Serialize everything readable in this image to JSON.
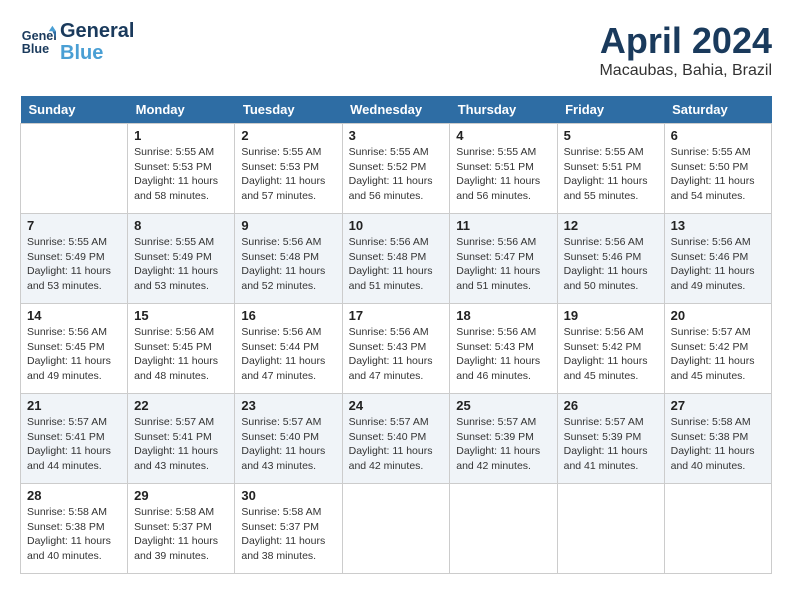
{
  "header": {
    "logo_line1": "General",
    "logo_line2": "Blue",
    "month": "April 2024",
    "location": "Macaubas, Bahia, Brazil"
  },
  "weekdays": [
    "Sunday",
    "Monday",
    "Tuesday",
    "Wednesday",
    "Thursday",
    "Friday",
    "Saturday"
  ],
  "weeks": [
    [
      {
        "day": "",
        "info": ""
      },
      {
        "day": "1",
        "info": "Sunrise: 5:55 AM\nSunset: 5:53 PM\nDaylight: 11 hours\nand 58 minutes."
      },
      {
        "day": "2",
        "info": "Sunrise: 5:55 AM\nSunset: 5:53 PM\nDaylight: 11 hours\nand 57 minutes."
      },
      {
        "day": "3",
        "info": "Sunrise: 5:55 AM\nSunset: 5:52 PM\nDaylight: 11 hours\nand 56 minutes."
      },
      {
        "day": "4",
        "info": "Sunrise: 5:55 AM\nSunset: 5:51 PM\nDaylight: 11 hours\nand 56 minutes."
      },
      {
        "day": "5",
        "info": "Sunrise: 5:55 AM\nSunset: 5:51 PM\nDaylight: 11 hours\nand 55 minutes."
      },
      {
        "day": "6",
        "info": "Sunrise: 5:55 AM\nSunset: 5:50 PM\nDaylight: 11 hours\nand 54 minutes."
      }
    ],
    [
      {
        "day": "7",
        "info": "Sunrise: 5:55 AM\nSunset: 5:49 PM\nDaylight: 11 hours\nand 53 minutes."
      },
      {
        "day": "8",
        "info": "Sunrise: 5:55 AM\nSunset: 5:49 PM\nDaylight: 11 hours\nand 53 minutes."
      },
      {
        "day": "9",
        "info": "Sunrise: 5:56 AM\nSunset: 5:48 PM\nDaylight: 11 hours\nand 52 minutes."
      },
      {
        "day": "10",
        "info": "Sunrise: 5:56 AM\nSunset: 5:48 PM\nDaylight: 11 hours\nand 51 minutes."
      },
      {
        "day": "11",
        "info": "Sunrise: 5:56 AM\nSunset: 5:47 PM\nDaylight: 11 hours\nand 51 minutes."
      },
      {
        "day": "12",
        "info": "Sunrise: 5:56 AM\nSunset: 5:46 PM\nDaylight: 11 hours\nand 50 minutes."
      },
      {
        "day": "13",
        "info": "Sunrise: 5:56 AM\nSunset: 5:46 PM\nDaylight: 11 hours\nand 49 minutes."
      }
    ],
    [
      {
        "day": "14",
        "info": "Sunrise: 5:56 AM\nSunset: 5:45 PM\nDaylight: 11 hours\nand 49 minutes."
      },
      {
        "day": "15",
        "info": "Sunrise: 5:56 AM\nSunset: 5:45 PM\nDaylight: 11 hours\nand 48 minutes."
      },
      {
        "day": "16",
        "info": "Sunrise: 5:56 AM\nSunset: 5:44 PM\nDaylight: 11 hours\nand 47 minutes."
      },
      {
        "day": "17",
        "info": "Sunrise: 5:56 AM\nSunset: 5:43 PM\nDaylight: 11 hours\nand 47 minutes."
      },
      {
        "day": "18",
        "info": "Sunrise: 5:56 AM\nSunset: 5:43 PM\nDaylight: 11 hours\nand 46 minutes."
      },
      {
        "day": "19",
        "info": "Sunrise: 5:56 AM\nSunset: 5:42 PM\nDaylight: 11 hours\nand 45 minutes."
      },
      {
        "day": "20",
        "info": "Sunrise: 5:57 AM\nSunset: 5:42 PM\nDaylight: 11 hours\nand 45 minutes."
      }
    ],
    [
      {
        "day": "21",
        "info": "Sunrise: 5:57 AM\nSunset: 5:41 PM\nDaylight: 11 hours\nand 44 minutes."
      },
      {
        "day": "22",
        "info": "Sunrise: 5:57 AM\nSunset: 5:41 PM\nDaylight: 11 hours\nand 43 minutes."
      },
      {
        "day": "23",
        "info": "Sunrise: 5:57 AM\nSunset: 5:40 PM\nDaylight: 11 hours\nand 43 minutes."
      },
      {
        "day": "24",
        "info": "Sunrise: 5:57 AM\nSunset: 5:40 PM\nDaylight: 11 hours\nand 42 minutes."
      },
      {
        "day": "25",
        "info": "Sunrise: 5:57 AM\nSunset: 5:39 PM\nDaylight: 11 hours\nand 42 minutes."
      },
      {
        "day": "26",
        "info": "Sunrise: 5:57 AM\nSunset: 5:39 PM\nDaylight: 11 hours\nand 41 minutes."
      },
      {
        "day": "27",
        "info": "Sunrise: 5:58 AM\nSunset: 5:38 PM\nDaylight: 11 hours\nand 40 minutes."
      }
    ],
    [
      {
        "day": "28",
        "info": "Sunrise: 5:58 AM\nSunset: 5:38 PM\nDaylight: 11 hours\nand 40 minutes."
      },
      {
        "day": "29",
        "info": "Sunrise: 5:58 AM\nSunset: 5:37 PM\nDaylight: 11 hours\nand 39 minutes."
      },
      {
        "day": "30",
        "info": "Sunrise: 5:58 AM\nSunset: 5:37 PM\nDaylight: 11 hours\nand 38 minutes."
      },
      {
        "day": "",
        "info": ""
      },
      {
        "day": "",
        "info": ""
      },
      {
        "day": "",
        "info": ""
      },
      {
        "day": "",
        "info": ""
      }
    ]
  ]
}
